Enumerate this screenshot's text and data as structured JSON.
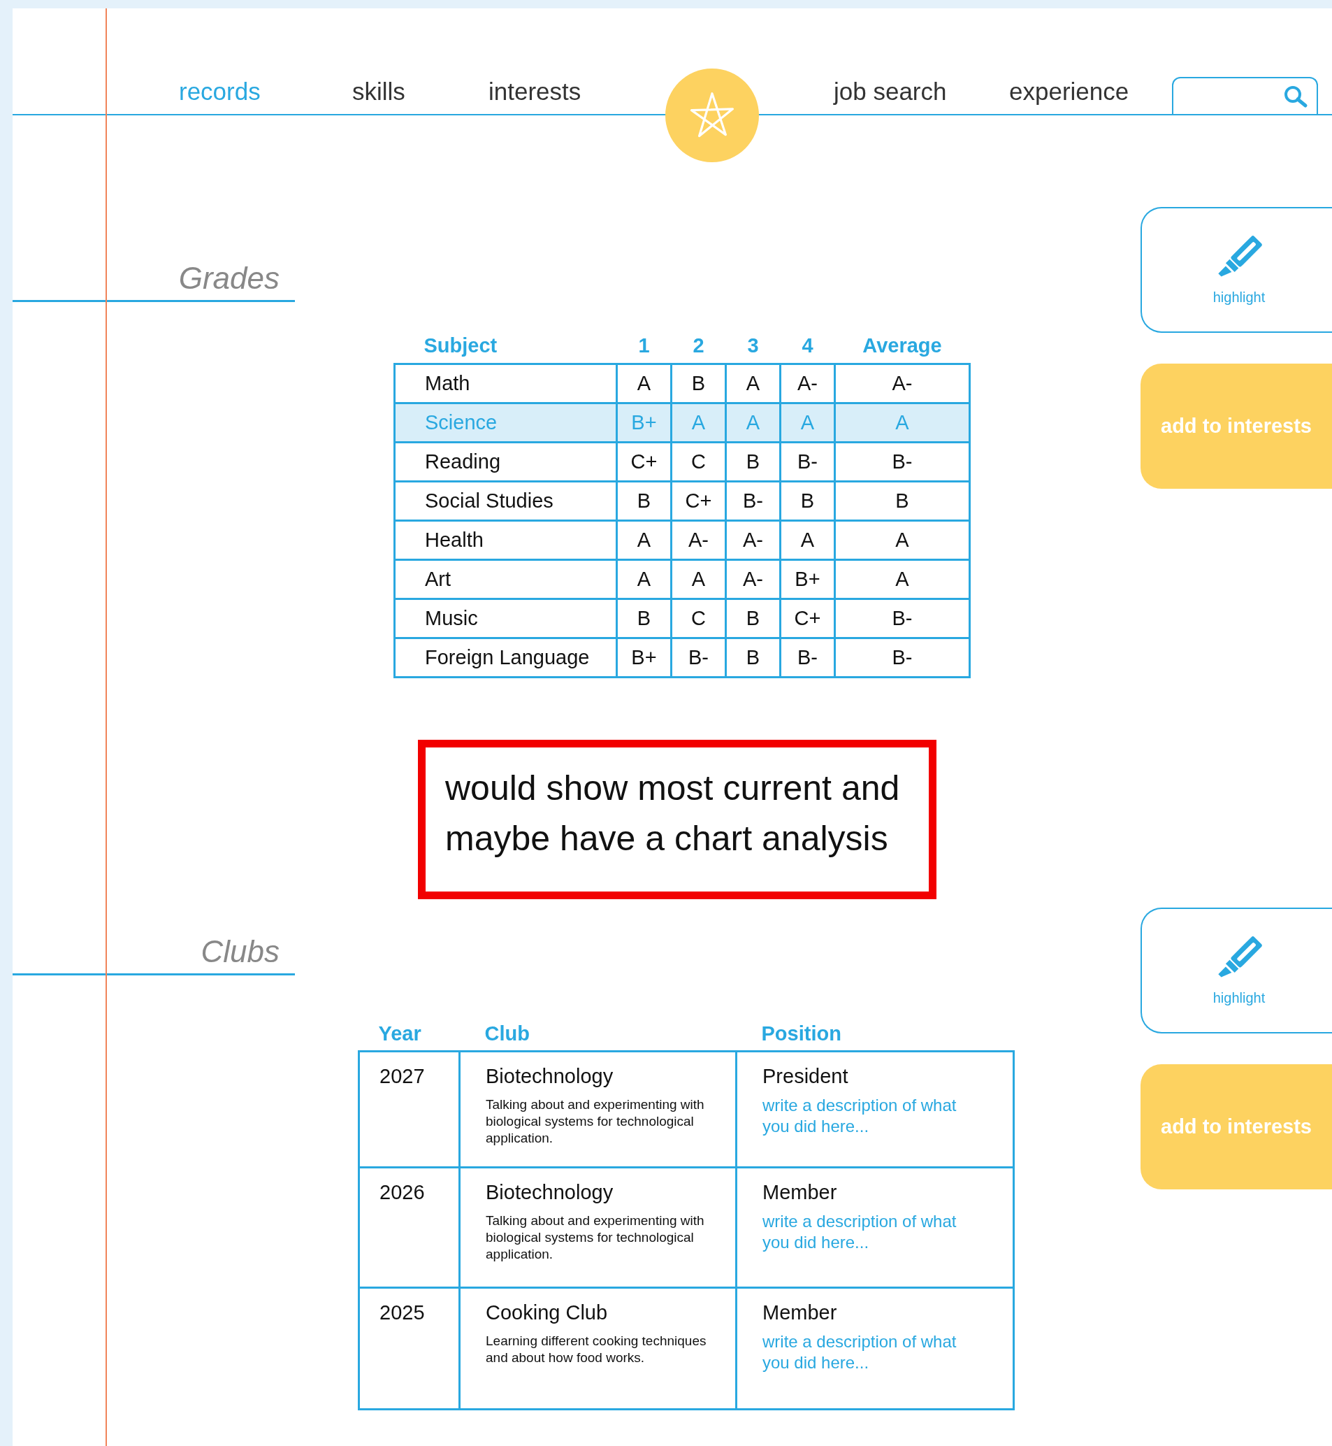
{
  "nav_left": [
    {
      "label": "records",
      "selected": true
    },
    {
      "label": "skills",
      "selected": false
    },
    {
      "label": "interests",
      "selected": false
    }
  ],
  "nav_right": [
    {
      "label": "job search",
      "selected": false
    },
    {
      "label": "experience",
      "selected": false
    }
  ],
  "sections": [
    {
      "heading": "Grades",
      "table": {
        "kind": "grades",
        "columns": [
          "Subject",
          "1",
          "2",
          "3",
          "4",
          "Average"
        ],
        "rows": [
          {
            "cells": [
              "Math",
              "A",
              "B",
              "A",
              "A-",
              "A-"
            ],
            "selected": false
          },
          {
            "cells": [
              "Science",
              "B+",
              "A",
              "A",
              "A",
              "A"
            ],
            "selected": true
          },
          {
            "cells": [
              "Reading",
              "C+",
              "C",
              "B",
              "B-",
              "B-"
            ],
            "selected": false
          },
          {
            "cells": [
              "Social Studies",
              "B",
              "C+",
              "B-",
              "B",
              "B"
            ],
            "selected": false
          },
          {
            "cells": [
              "Health",
              "A",
              "A-",
              "A-",
              "A",
              "A"
            ],
            "selected": false
          },
          {
            "cells": [
              "Art",
              "A",
              "A",
              "A-",
              "B+",
              "A"
            ],
            "selected": false
          },
          {
            "cells": [
              "Music",
              "B",
              "C",
              "B",
              "C+",
              "B-"
            ],
            "selected": false
          },
          {
            "cells": [
              "Foreign Language",
              "B+",
              "B-",
              "B",
              "B-",
              "B-"
            ],
            "selected": false
          }
        ]
      },
      "note": "would show most current and maybe have a chart analysis",
      "actions": [
        {
          "kind": "highlight",
          "label": "highlight"
        },
        {
          "kind": "add",
          "label": "add to interests"
        }
      ]
    },
    {
      "heading": "Clubs",
      "table": {
        "kind": "clubs",
        "columns": [
          "Year",
          "Club",
          "Position"
        ],
        "rows": [
          {
            "year": "2027",
            "club": "Biotechnology",
            "description": "Talking about and experimenting with biological systems for technological application.",
            "position": "President",
            "prompt": "write a description of what you did here..."
          },
          {
            "year": "2026",
            "club": "Biotechnology",
            "description": "Talking about and experimenting with biological systems for technological application.",
            "position": "Member",
            "prompt": "write a description of what you did here..."
          },
          {
            "year": "2025",
            "club": "Cooking Club",
            "description": "Learning different cooking techniques and about how food works.",
            "position": "Member",
            "prompt": "write a description of what you did here..."
          }
        ]
      },
      "actions": [
        {
          "kind": "highlight",
          "label": "highlight"
        },
        {
          "kind": "add",
          "label": "add to interests"
        }
      ]
    }
  ]
}
